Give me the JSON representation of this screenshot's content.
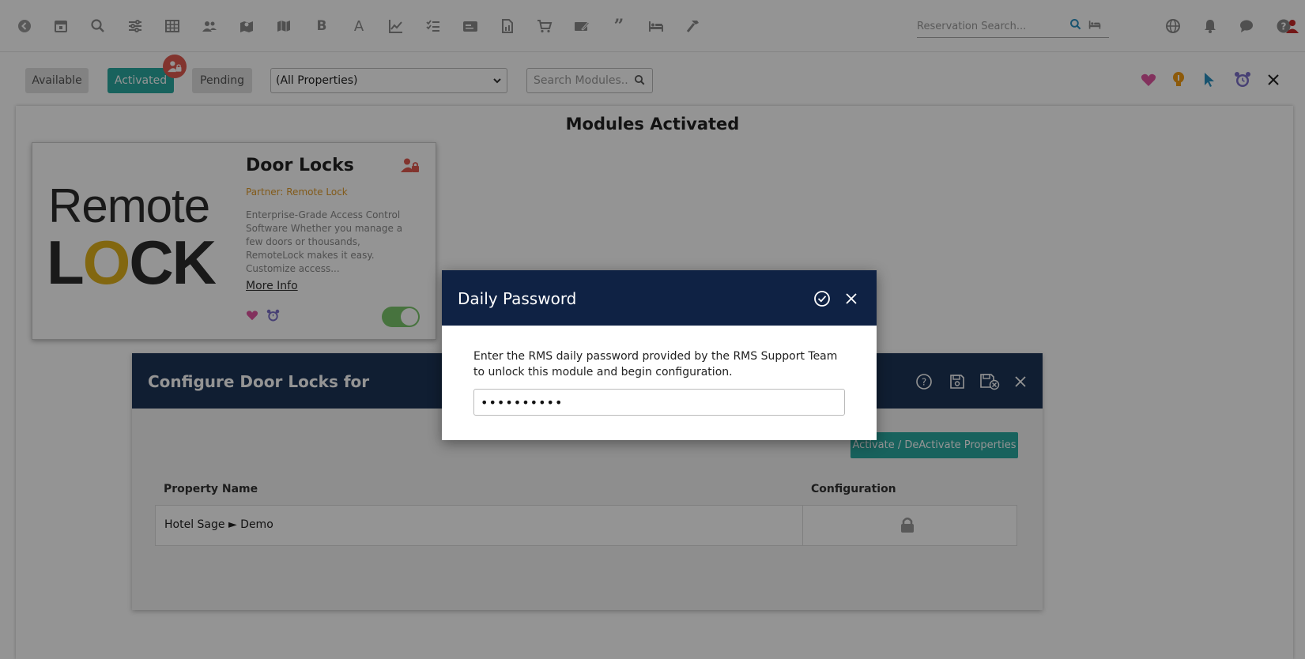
{
  "topbar": {
    "icons": [
      "back-icon",
      "calendar-icon",
      "search-icon",
      "sliders-icon",
      "grid-icon",
      "users-icon",
      "map-pin-icon",
      "map-icon",
      "bold-icon",
      "font-icon",
      "chart-line-icon",
      "checklist-icon",
      "card-icon",
      "document-icon",
      "cart-icon",
      "signature-icon",
      "quote-icon",
      "bed-icon",
      "hammer-icon"
    ],
    "reservation_search_placeholder": "Reservation Search...",
    "right_icons": [
      "globe-icon",
      "bell-icon",
      "chat-icon",
      "help-icon",
      "user-icon"
    ]
  },
  "filters": {
    "available_label": "Available",
    "activated_label": "Activated",
    "pending_label": "Pending",
    "property_select_value": "(All Properties)",
    "module_search_placeholder": "Search Modules..."
  },
  "page": {
    "title": "Modules Activated"
  },
  "module_card": {
    "logo_line1": "Remote",
    "logo_line2_a": "L",
    "logo_line2_o": "O",
    "logo_line2_b": "CK",
    "title": "Door Locks",
    "partner": "Partner: Remote Lock",
    "description": "Enterprise-Grade Access Control Software Whether you manage a few doors or thousands, RemoteLock makes it easy. Customize access...",
    "more_info": "More Info",
    "toggle_on": true
  },
  "configure": {
    "title": "Configure Door Locks for",
    "activate_button": "Activate / DeActivate Properties",
    "columns": {
      "property_name": "Property Name",
      "configuration": "Configuration"
    },
    "rows": [
      {
        "property_name": "Hotel Sage ► Demo"
      }
    ]
  },
  "modal": {
    "title": "Daily Password",
    "message": "Enter the RMS daily password provided by the RMS Support Team to unlock this module and begin configuration.",
    "password_value": "••••••••••"
  },
  "colors": {
    "accent_teal": "#2aa9a1",
    "header_navy": "#1d3557",
    "modal_navy": "#0f2244",
    "badge_red": "#e05a50"
  }
}
